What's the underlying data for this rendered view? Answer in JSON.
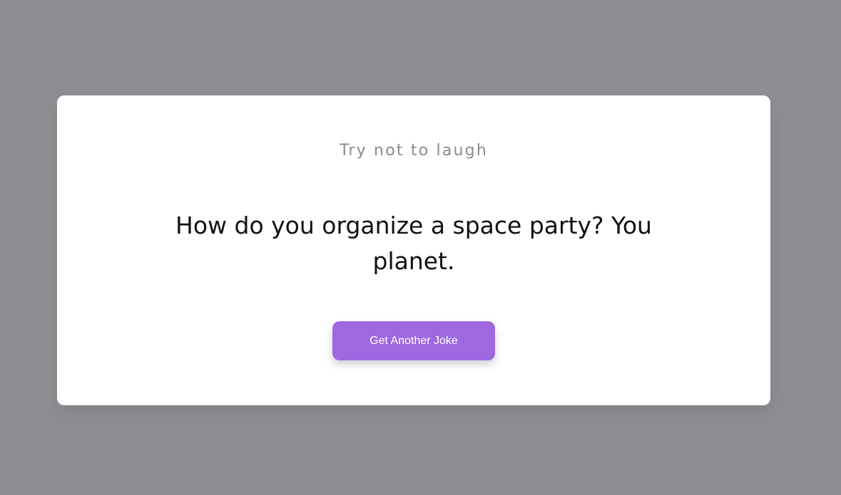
{
  "card": {
    "subtitle": "Try not to laugh",
    "joke": "How do you organize a space party? You planet.",
    "button_label": "Get Another Joke"
  },
  "colors": {
    "background": "#8e8d92",
    "card": "#ffffff",
    "accent": "#9f68e0",
    "subtitle_text": "#8a8a8a",
    "joke_text": "#111111"
  }
}
